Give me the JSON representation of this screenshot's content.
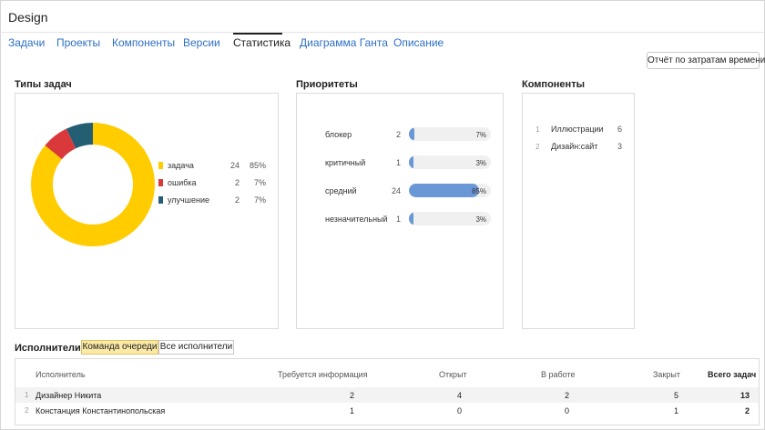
{
  "header": {
    "title": "Design"
  },
  "tabs": [
    {
      "label": "Задачи"
    },
    {
      "label": "Проекты"
    },
    {
      "label": "Компоненты"
    },
    {
      "label": "Версии"
    },
    {
      "label": "Статистика"
    },
    {
      "label": "Диаграмма Ганта"
    },
    {
      "label": "Описание"
    }
  ],
  "active_tab": "Статистика",
  "toolbar": {
    "report_label": "Отчёт по затратам времени"
  },
  "task_types": {
    "title": "Типы задач",
    "items": [
      {
        "label": "задача",
        "count": "24",
        "percent": "85%",
        "share": 85,
        "color": "#ffcc00"
      },
      {
        "label": "ошибка",
        "count": "2",
        "percent": "7%",
        "share": 7,
        "color": "#d9393b"
      },
      {
        "label": "улучшение",
        "count": "2",
        "percent": "7%",
        "share": 7,
        "color": "#245e73"
      }
    ]
  },
  "priorities": {
    "title": "Приоритеты",
    "items": [
      {
        "label": "блокер",
        "count": "2",
        "percent": "7%",
        "share": 7
      },
      {
        "label": "критичный",
        "count": "1",
        "percent": "3%",
        "share": 3
      },
      {
        "label": "средний",
        "count": "24",
        "percent": "85%",
        "share": 85
      },
      {
        "label": "незначительный",
        "count": "1",
        "percent": "3%",
        "share": 3
      }
    ],
    "bar_color": "#6a98d6"
  },
  "components": {
    "title": "Компоненты",
    "items": [
      {
        "index": "1",
        "name": "Иллюстрации",
        "count": "6"
      },
      {
        "index": "2",
        "name": "Дизайн:сайт",
        "count": "3"
      }
    ]
  },
  "assignees": {
    "title": "Исполнители",
    "toggle_team": "Команда очереди",
    "toggle_all": "Все исполнители",
    "columns": [
      "Исполнитель",
      "Требуется информация",
      "Открыт",
      "В работе",
      "Закрыт",
      "Всего задач"
    ],
    "rows": [
      {
        "index": "1",
        "name": "Дизайнер Никита",
        "need_info": "2",
        "open": "4",
        "in_progress": "2",
        "closed": "5",
        "total": "13"
      },
      {
        "index": "2",
        "name": "Констанция Константинопольская",
        "need_info": "1",
        "open": "0",
        "in_progress": "0",
        "closed": "1",
        "total": "2"
      }
    ]
  }
}
